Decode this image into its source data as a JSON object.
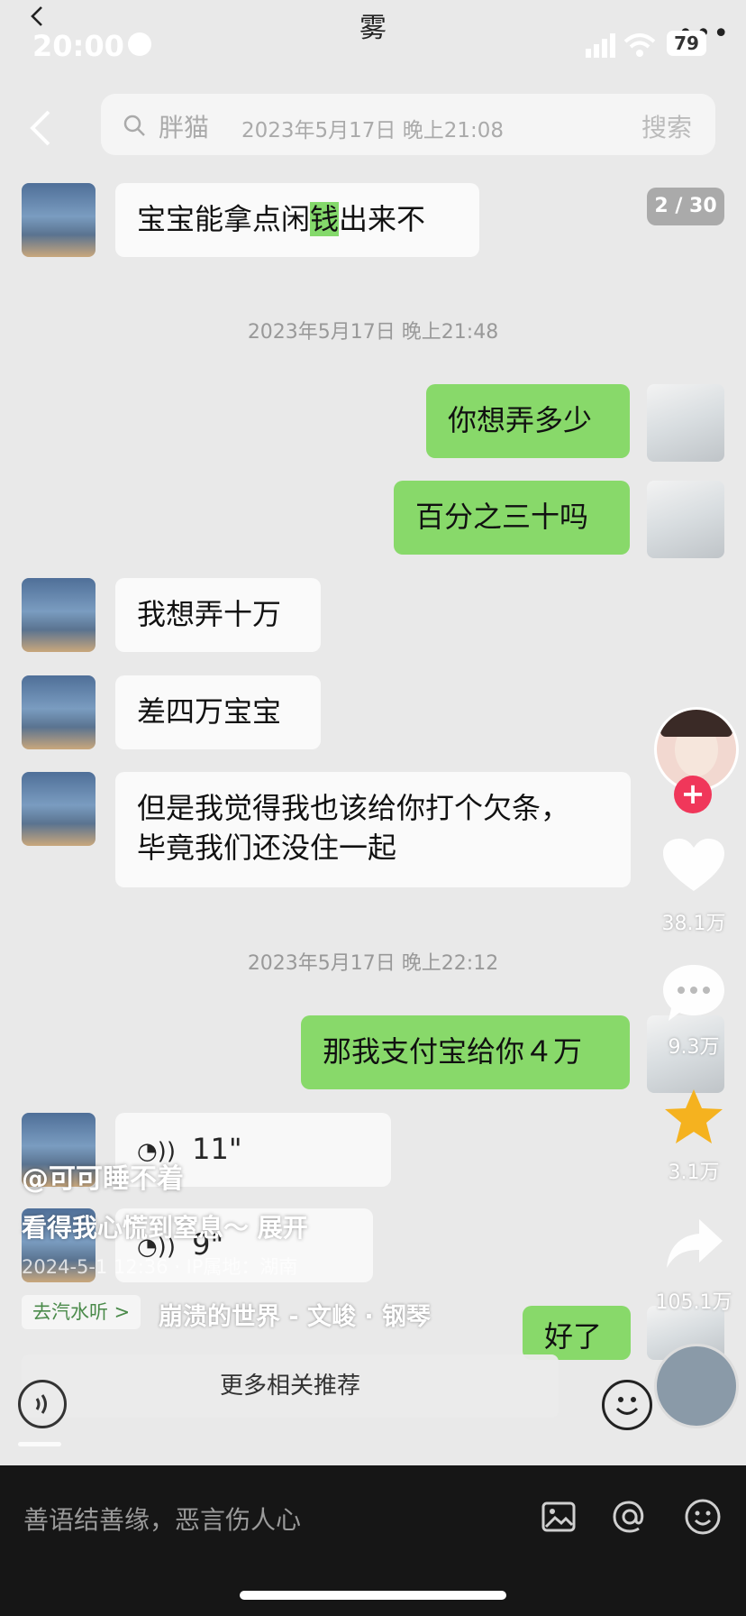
{
  "header": {
    "title": "雾",
    "more_icon": "more-icon"
  },
  "status_bar": {
    "time": "20:00",
    "battery": "79"
  },
  "search": {
    "keyword": "胖猫",
    "date": "2023年5月17日 晚上21:08",
    "button": "搜索"
  },
  "result_counter": "2 / 30",
  "messages": {
    "m1": {
      "pre": "宝宝能拿点闲",
      "highlight": "钱",
      "post": "出来不"
    },
    "ts1": "2023年5月17日 晚上21:48",
    "m2": "你想弄多少",
    "m3": "百分之三十吗",
    "m4": "我想弄十万",
    "m5": "差四万宝宝",
    "m6_line1": "但是我觉得我也该给你打个欠条，",
    "m6_line2": "毕竟我们还没住一起",
    "ts2": "2023年5月17日 晚上22:12",
    "m7": "那我支付宝给你４万",
    "voice1": "11\"",
    "voice2": "9\"",
    "m8": "好了"
  },
  "sidebar": {
    "follow_plus": "+",
    "likes": "38.1万",
    "comments": "9.3万",
    "favorites": "3.1万",
    "shares": "105.1万"
  },
  "overlay": {
    "author": "@可可睡不着",
    "description": "看得我心慌到窒息～  展开",
    "meta": "2024-5-1 12:36 · IP属地：湖南",
    "music_tag": "去汽水听 >",
    "music_title": "崩溃的世界 - 文峻 · 钢琴",
    "related": "更多相关推荐"
  },
  "comment": {
    "placeholder": "善语结善缘，恶言伤人心"
  }
}
